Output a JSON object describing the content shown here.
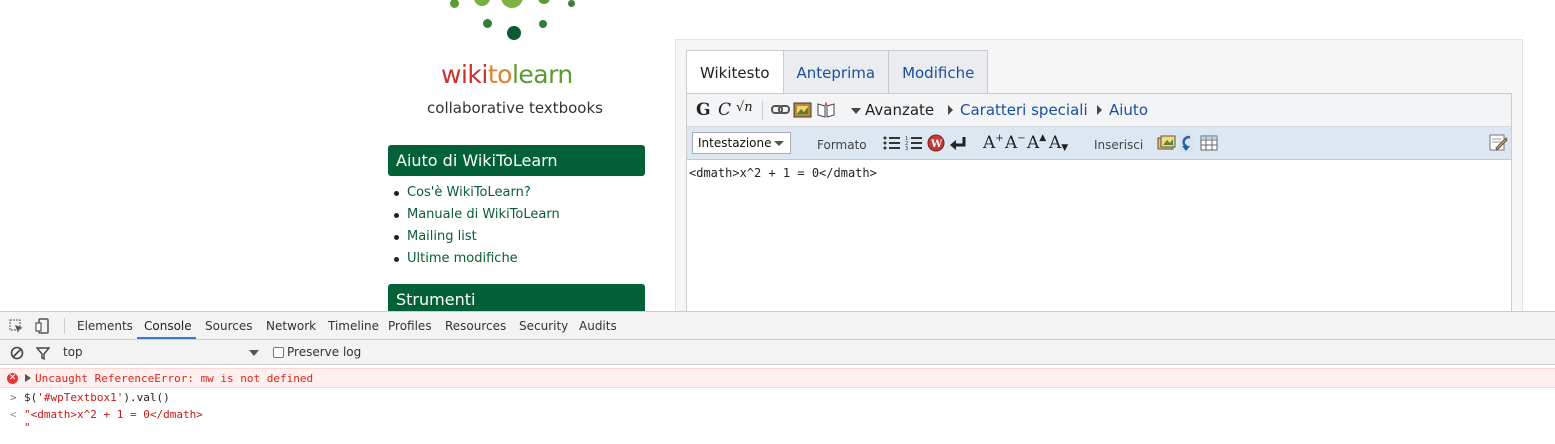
{
  "site": {
    "logo": {
      "part1": "wiki",
      "part2": "to",
      "part3": "learn"
    },
    "tagline": "collaborative textbooks",
    "colors": {
      "brand_green": "#03613a",
      "link_green": "#0a5d34",
      "logo_red": "#c8312c",
      "logo_orange": "#e0812b",
      "logo_green": "#5b9b32"
    }
  },
  "sidebar": {
    "help_title": "Aiuto di WikiToLearn",
    "help_items": [
      "Cos'è WikiToLearn?",
      "Manuale di WikiToLearn",
      "Mailing list",
      "Ultime modifiche"
    ],
    "tools_title": "Strumenti"
  },
  "editor": {
    "tabs": [
      "Wikitesto",
      "Anteprima",
      "Modifiche"
    ],
    "toolbar": {
      "bold_glyph": "G",
      "italic_glyph": "C",
      "sqrt_glyph": "√n",
      "advanced": "Avanzate",
      "special_chars": "Caratteri speciali",
      "help": "Aiuto"
    },
    "secondary": {
      "heading_select": "Intestazione",
      "format": "Formato",
      "insert": "Inserisci",
      "font_sizes": [
        "A+",
        "A-",
        "A^",
        "Av"
      ]
    },
    "content": "<dmath>x^2 + 1 = 0</dmath>"
  },
  "devtools": {
    "tabs": [
      "Elements",
      "Console",
      "Sources",
      "Network",
      "Timeline",
      "Profiles",
      "Resources",
      "Security",
      "Audits"
    ],
    "active_tab": "Console",
    "context": "top",
    "preserve_log": "Preserve log",
    "error": "Uncaught ReferenceError: mw is not defined",
    "input_prefix": "$(",
    "input_string": "'#wpTextbox1'",
    "input_suffix": ").val()",
    "output": "\"<dmath>x^2 + 1 = 0</dmath>\n\""
  }
}
